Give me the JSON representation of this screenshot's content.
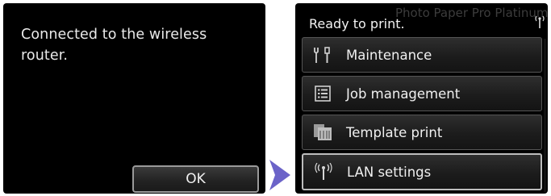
{
  "left_screen": {
    "message": "Connected to the wireless router.",
    "ok_label": "OK"
  },
  "right_screen": {
    "status": "Ready to print.",
    "background_text": "Photo Paper Pro Platinum",
    "status_icon": "wireless-signal-icon",
    "menu": [
      {
        "label": "Maintenance",
        "icon": "maintenance-tools-icon"
      },
      {
        "label": "Job management",
        "icon": "list-icon"
      },
      {
        "label": "Template print",
        "icon": "template-icon"
      },
      {
        "label": "LAN settings",
        "icon": "wireless-lan-icon",
        "selected": true
      }
    ]
  },
  "colors": {
    "screen_bg": "#000000",
    "text": "#f0f0f0",
    "arrow": "#6b63c8"
  }
}
